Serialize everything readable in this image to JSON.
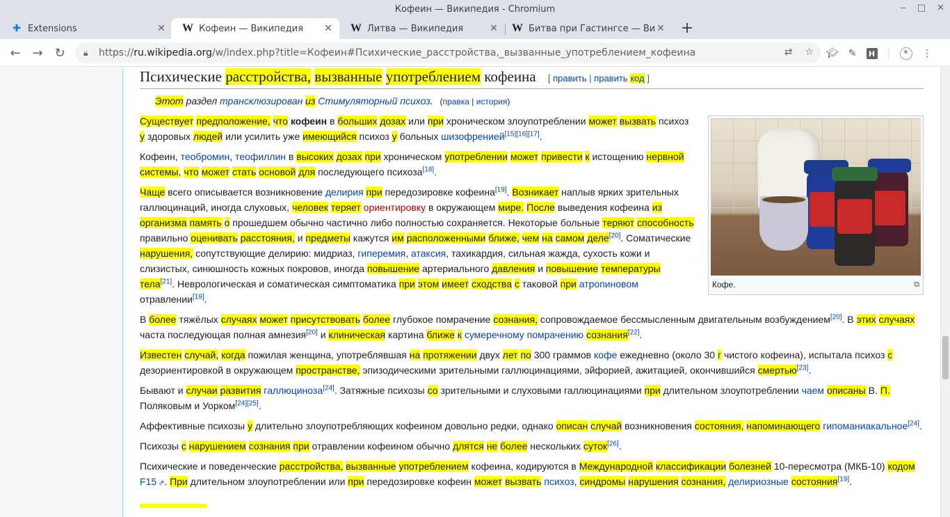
{
  "window": {
    "title": "Кофеин — Википедия - Chromium"
  },
  "tabs": [
    {
      "label": "Extensions",
      "icon": "puzzle-icon"
    },
    {
      "label": "Кофеин — Википедия",
      "icon": "wikipedia-icon"
    },
    {
      "label": "Литва — Википедия",
      "icon": "wikipedia-icon"
    },
    {
      "label": "Битва при Гастингсе — Вики",
      "icon": "wikipedia-icon"
    }
  ],
  "toolbar": {
    "url_host_prefix": "https://",
    "url_host": "ru.wikipedia.org",
    "url_rest": "/w/index.php?title=Кофеин#Психические_расстройства,_вызванные_употреблением_кофеина"
  },
  "section": {
    "title_parts": [
      "Психические ",
      "расстройства,",
      " ",
      "вызванные",
      " ",
      "употреблением",
      " кофеина"
    ],
    "edit_open": "[",
    "edit": "править",
    "sep": "|",
    "edit_code_pre": "править ",
    "edit_code": "код",
    "edit_close": "]"
  },
  "hatnote": {
    "p1": "Этот",
    "p2": " раздел ",
    "link1": "трансклюзирован",
    "p3": " ",
    "p4": "из",
    "p5": " ",
    "link2": "Стимуляторный психоз",
    "p6": ".",
    "open": "(",
    "edit": "правка",
    "sep": " | ",
    "history": "история",
    "close": ")"
  },
  "figure": {
    "caption": "Кофе."
  }
}
